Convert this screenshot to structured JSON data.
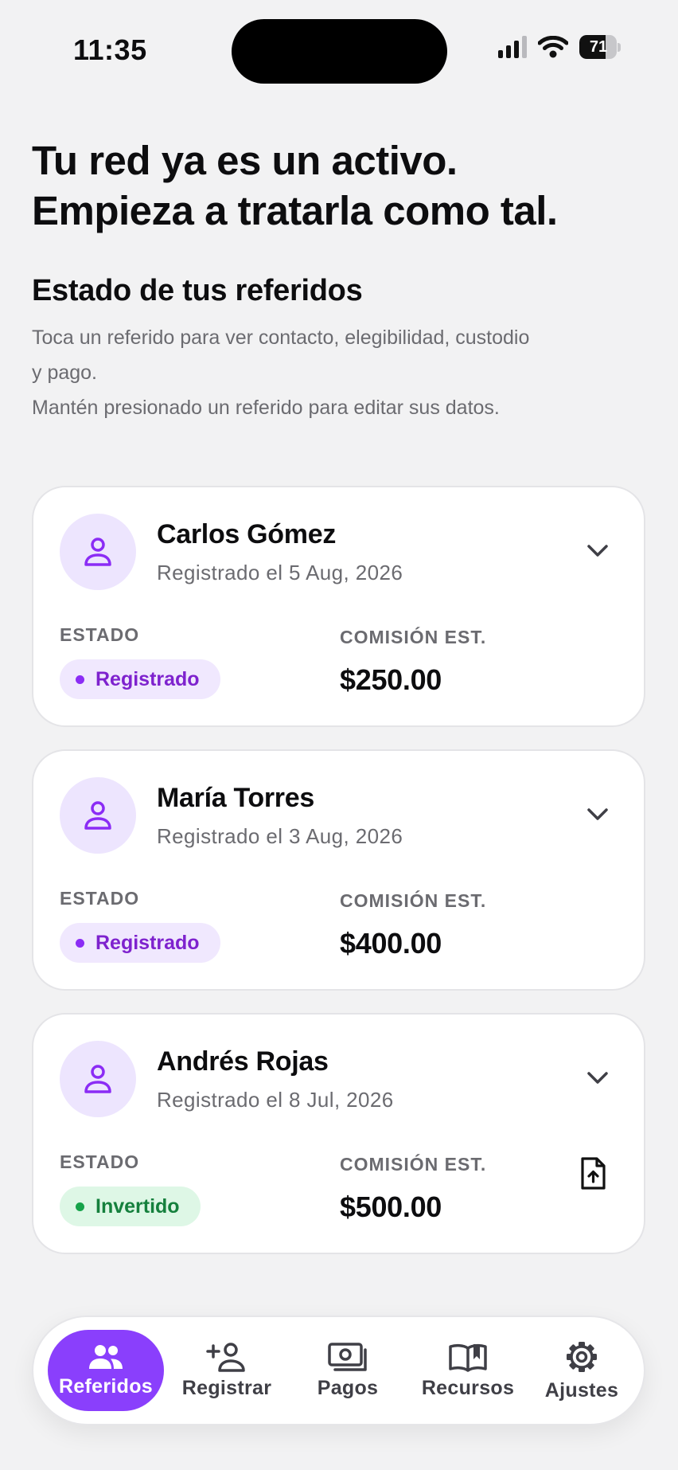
{
  "status_bar": {
    "time": "11:35",
    "battery": "71",
    "battery_level": 0.71
  },
  "header": {
    "headline_line1": "Tu red ya es un activo.",
    "headline_line2": "Empieza a tratarla como tal."
  },
  "section": {
    "title": "Estado de tus referidos",
    "desc_line1": "Toca un referido para ver contacto, elegibilidad, custodio",
    "desc_line2": "y pago.",
    "desc_line3": "Mantén presionado un referido para editar sus datos."
  },
  "labels": {
    "estado": "ESTADO",
    "comision": "COMISIÓN EST."
  },
  "referrals": [
    {
      "name": "Carlos Gómez",
      "date": "Registrado el 5 Aug, 2026",
      "status": "Registrado",
      "commission": "$250.00"
    },
    {
      "name": "María Torres",
      "date": "Registrado el 3 Aug, 2026",
      "status": "Registrado",
      "commission": "$400.00"
    },
    {
      "name": "Andrés Rojas",
      "date": "Registrado el 8 Jul, 2026",
      "status": "Invertido",
      "commission": "$500.00"
    }
  ],
  "nav": [
    {
      "label": "Referidos",
      "icon": "people-icon",
      "active": true
    },
    {
      "label": "Registrar",
      "icon": "add-person-icon"
    },
    {
      "label": "Pagos",
      "icon": "payments-icon"
    },
    {
      "label": "Recursos",
      "icon": "book-icon"
    },
    {
      "label": "Ajustes",
      "icon": "gear-icon"
    }
  ],
  "colors": {
    "accent": "#8a3ffc",
    "badge_registered_bg": "#f0e8fe",
    "badge_registered_text": "#7e22ce",
    "badge_invested_bg": "#def7e6",
    "badge_invested_text": "#15803d"
  }
}
